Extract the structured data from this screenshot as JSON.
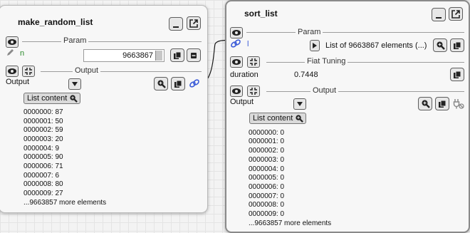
{
  "node1": {
    "title": "make_random_list",
    "param_label": "Param",
    "param_name": "n",
    "param_value": "9663867",
    "output_label": "Output",
    "output_text": "Output",
    "list_button": "List content",
    "items": [
      "0000000: 87",
      "0000001: 50",
      "0000002: 59",
      "0000003: 20",
      "0000004: 9",
      "0000005: 90",
      "0000006: 71",
      "0000007: 6",
      "0000008: 80",
      "0000009: 27"
    ],
    "more": "...9663857 more elements"
  },
  "node2": {
    "title": "sort_list",
    "param_label": "Param",
    "param_name": "l",
    "param_value": "List of 9663867 elements (...)",
    "fiat_label": "Fiat Tuning",
    "duration_name": "duration",
    "duration_value": "0.7448",
    "output_label": "Output",
    "output_text": "Output",
    "list_button": "List content",
    "items": [
      "0000000: 0",
      "0000001: 0",
      "0000002: 0",
      "0000003: 0",
      "0000004: 0",
      "0000005: 0",
      "0000006: 0",
      "0000007: 0",
      "0000008: 0",
      "0000009: 0"
    ],
    "more": "...9663857 more elements"
  },
  "colors": {
    "link": "#3b5bd8",
    "name_green": "#2a8a2a"
  }
}
